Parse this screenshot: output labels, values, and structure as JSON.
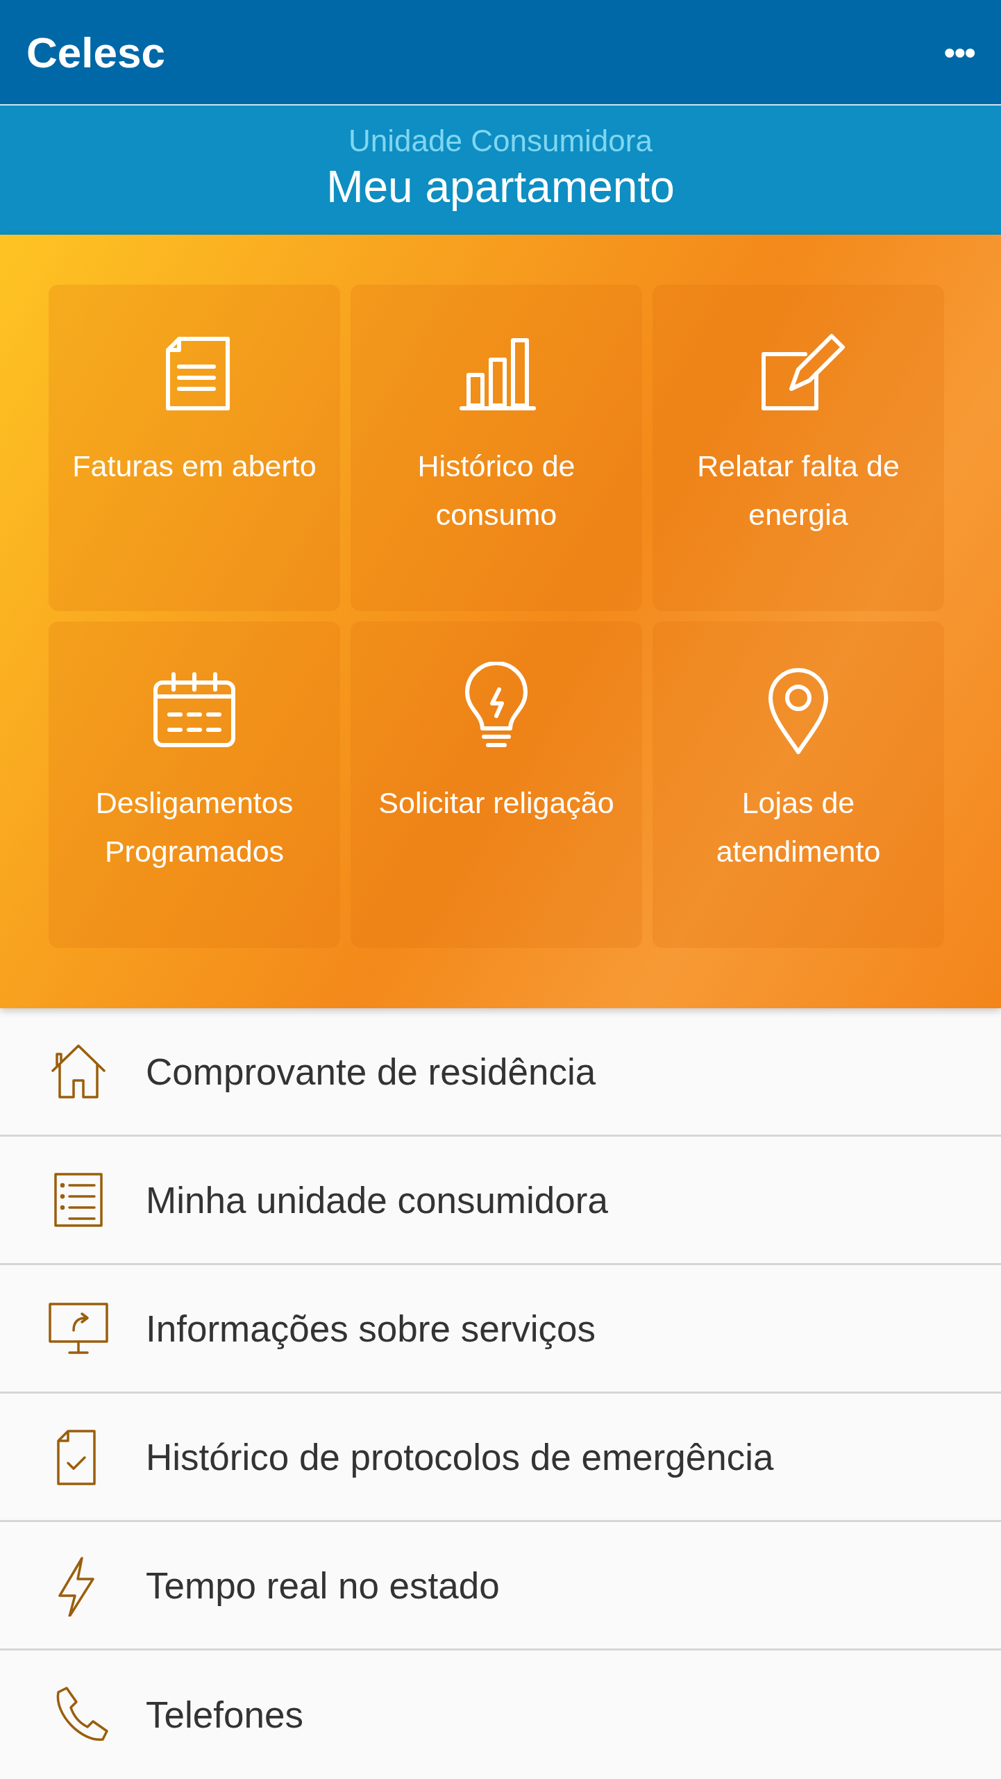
{
  "app_bar": {
    "title": "Celesc",
    "menu": "•••"
  },
  "header": {
    "subtitle": "Unidade Consumidora",
    "title": "Meu apartamento"
  },
  "tiles": [
    {
      "label": "Faturas em aberto",
      "kind": "document"
    },
    {
      "label": "Histórico de consumo",
      "kind": "bars"
    },
    {
      "label": "Relatar falta de energia",
      "kind": "edit"
    },
    {
      "label": "Desligamentos Programados",
      "kind": "calendar"
    },
    {
      "label": "Solicitar religação",
      "kind": "bulb"
    },
    {
      "label": "Lojas de atendimento",
      "kind": "pin"
    }
  ],
  "menu_items": [
    {
      "label": "Comprovante de residência",
      "kind": "house"
    },
    {
      "label": "Minha unidade consumidora",
      "kind": "list"
    },
    {
      "label": "Informações sobre serviços",
      "kind": "monitor"
    },
    {
      "label": "Histórico de protocolos de emergência",
      "kind": "file-check"
    },
    {
      "label": "Tempo real no estado",
      "kind": "bolt"
    },
    {
      "label": "Telefones",
      "kind": "phone"
    }
  ]
}
